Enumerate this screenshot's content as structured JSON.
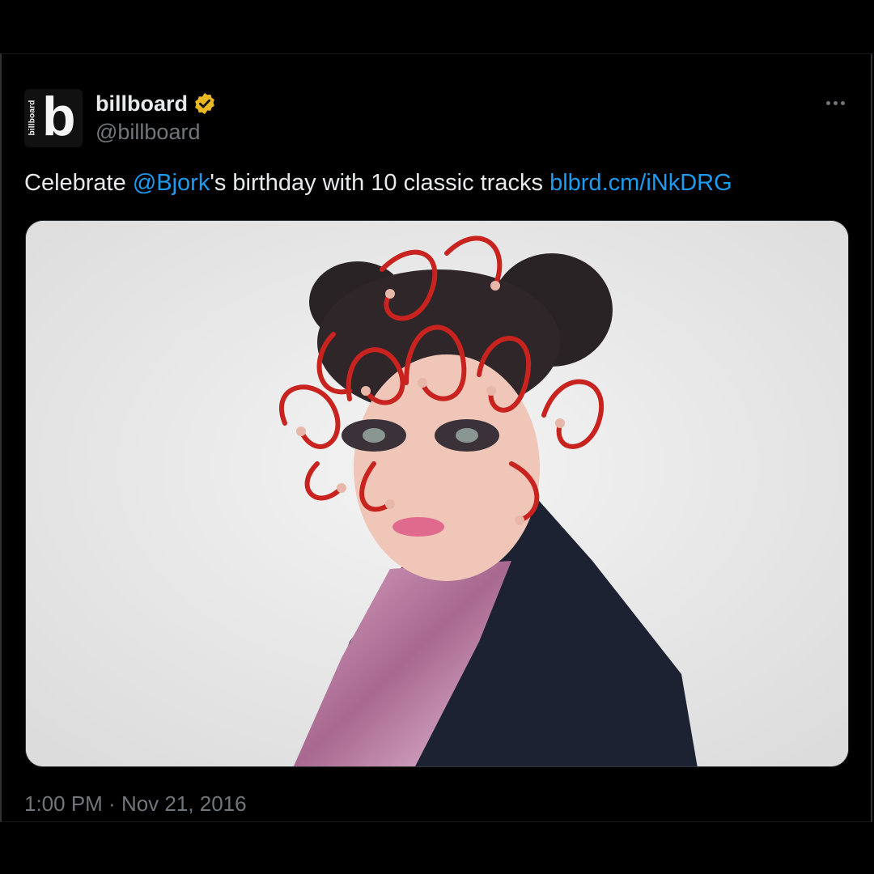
{
  "account": {
    "display_name": "billboard",
    "handle": "@billboard",
    "avatar_label": "billboard",
    "avatar_letter": "b",
    "verified_color": "#e8b923"
  },
  "tweet": {
    "text_before": "Celebrate ",
    "mention": "@Bjork",
    "text_after": "'s birthday with 10 classic tracks ",
    "link": "blbrd.cm/iNkDRG"
  },
  "timestamp": {
    "time": "1:00 PM",
    "separator": " · ",
    "date": "Nov 21, 2016"
  },
  "colors": {
    "background": "#000000",
    "text": "#e7e9ea",
    "secondary": "#71767b",
    "link": "#1d9bf0"
  },
  "icons": {
    "verified": "verified-badge-icon",
    "more": "more-options-icon"
  }
}
